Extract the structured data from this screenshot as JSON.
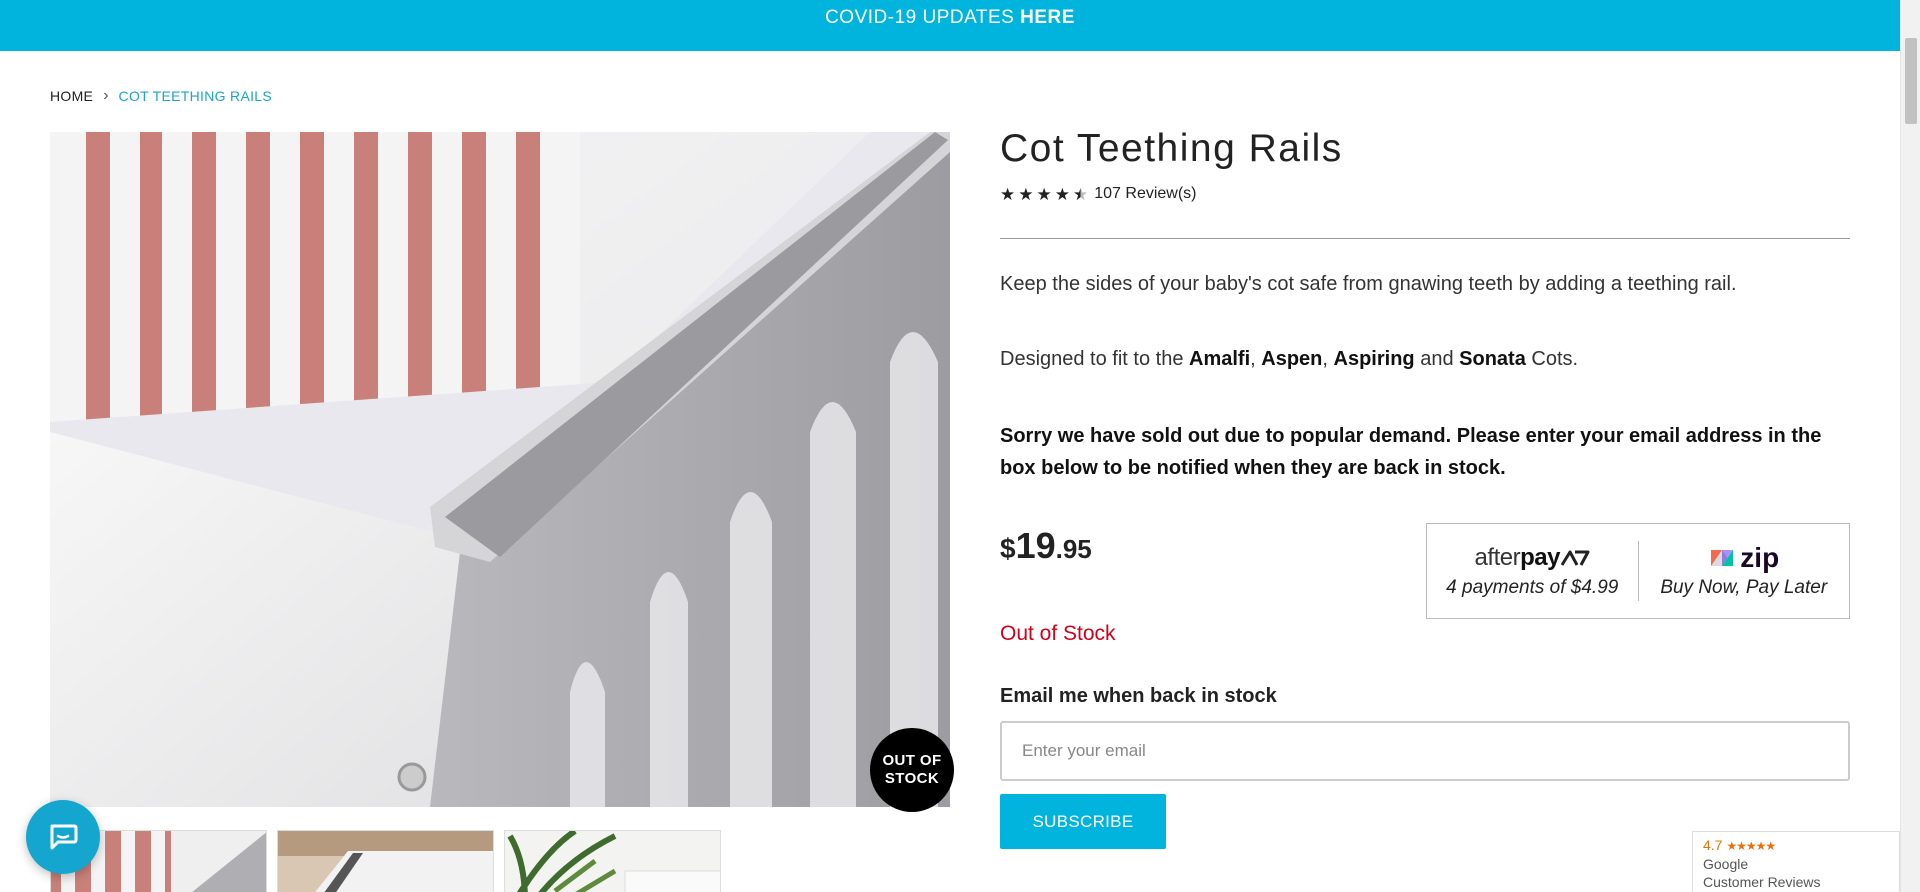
{
  "topbar": {
    "text": "COVID-19 UPDATES",
    "link": "HERE"
  },
  "breadcrumb": {
    "home": "HOME",
    "separator": "›",
    "current": "COT TEETHING RAILS"
  },
  "product": {
    "title": "Cot Teething Rails",
    "rating": 4.5,
    "reviews": "107 Review(s)",
    "description": "Keep the sides of your baby's cot safe from gnawing teeth by adding a teething rail.",
    "fit_prefix": "Designed to fit to the",
    "fit_models": [
      "Amalfi",
      "Aspen",
      "Aspiring",
      "Sonata"
    ],
    "fit_comma": ",",
    "fit_and": "and",
    "fit_suffix": "Cots.",
    "soldout_message": "Sorry we have sold out due to popular demand. Please enter your email address in the box below to be notified when they are back in stock.",
    "price": {
      "currency": "$",
      "dollars": "19",
      "cents": ".95"
    },
    "stock_status": "Out of Stock",
    "badge_line1": "OUT OF",
    "badge_line2": "STOCK"
  },
  "payment": {
    "afterpay_logo_light": "after",
    "afterpay_logo_bold": "pay",
    "afterpay_caption": "4 payments of $4.99",
    "zip_logo": "zip",
    "zip_caption": "Buy Now, Pay Later"
  },
  "notify": {
    "label": "Email me when back in stock",
    "placeholder": "Enter your email",
    "button": "SUBSCRIBE"
  },
  "google_badge": {
    "score": "4.7",
    "stars": "★★★★★",
    "line1": "Google",
    "line2": "Customer Reviews"
  },
  "colors": {
    "accent": "#00b4de",
    "out_of_stock": "#d0021b",
    "text": "#222222"
  }
}
